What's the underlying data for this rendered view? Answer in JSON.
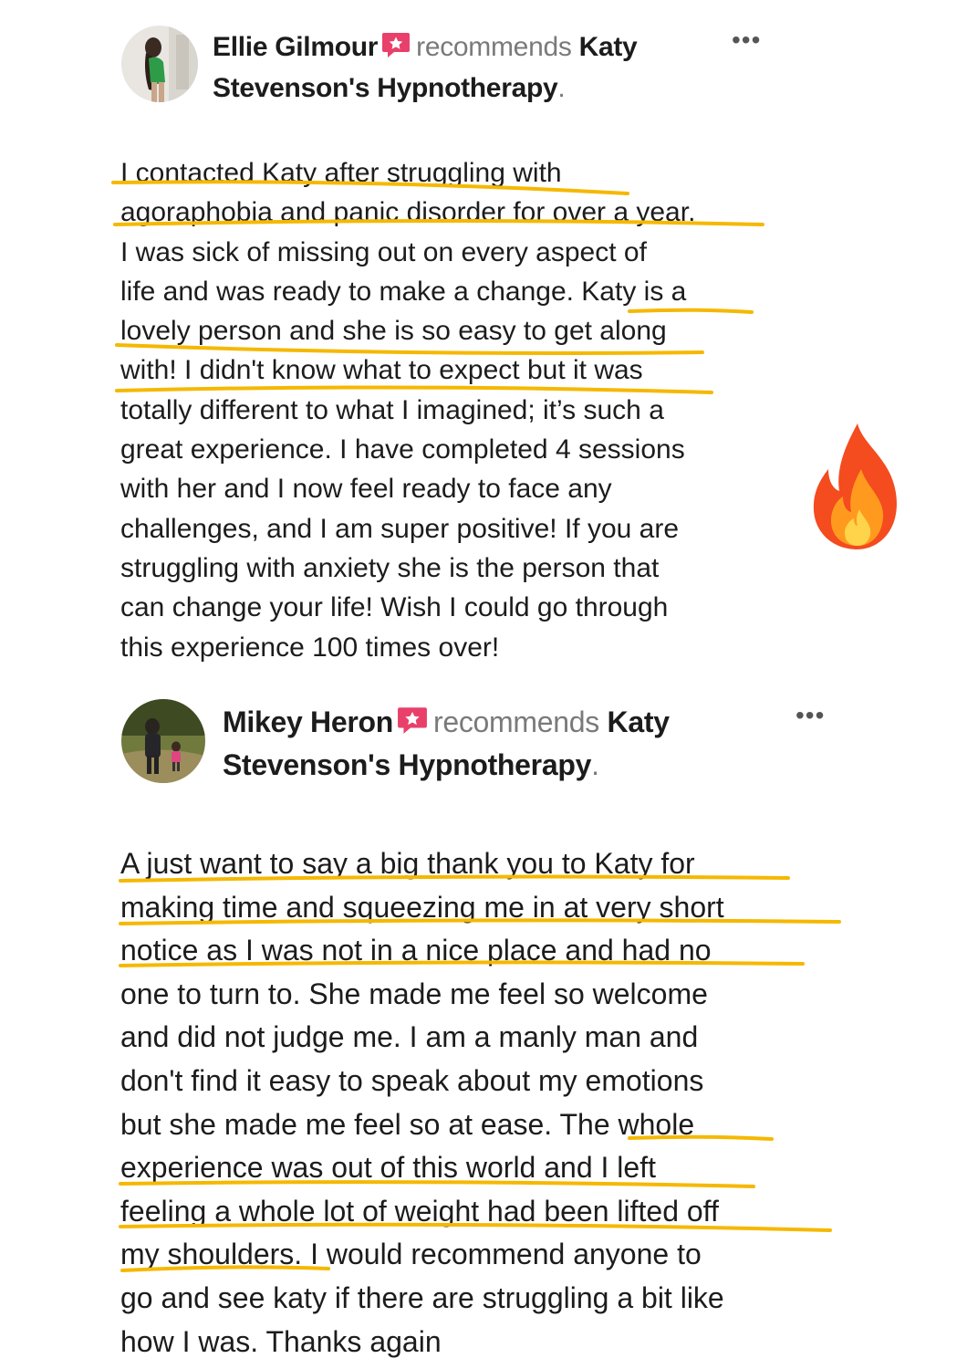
{
  "reviews": [
    {
      "author": "Ellie Gilmour",
      "recommends": "recommends",
      "business_line1": "Katy",
      "business_line2": "Stevenson's Hypnotherapy",
      "period": ".",
      "more": "•••",
      "body_lines": [
        "I contacted Katy after struggling with",
        "agoraphobia and panic disorder for over a year.",
        "I was sick of missing out on every aspect of",
        "life and was ready to make a change. Katy is a",
        "lovely person and she is so easy to get along",
        "with! I didn't know what to expect but it was",
        "totally different to what I imagined; it’s such a",
        "great experience. I have completed 4 sessions",
        "with her and I now feel ready to face any",
        "challenges, and I am super positive! If you are",
        "struggling with anxiety she is the person that",
        "can change your life! Wish I could go through",
        "this experience 100 times over!"
      ]
    },
    {
      "author": "Mikey Heron",
      "recommends": "recommends",
      "business_line1": "Katy",
      "business_line2": "Stevenson's Hypnotherapy",
      "period": ".",
      "more": "•••",
      "body_lines": [
        "A just want to say a big thank you to Katy for",
        "making time and squeezing me in at very short",
        "notice as I was not in a nice place and had no",
        "one to turn to. She made me feel so welcome",
        "and did not judge me. I am a manly man and",
        "don't find it easy to speak about my emotions",
        "but she made me feel so at ease. The whole",
        "experience was out of this world and I left",
        "feeling a whole lot of weight had been lifted off",
        "my shoulders. I would recommend anyone to",
        "go and see katy if there are struggling a bit like",
        "how I was. Thanks again"
      ]
    }
  ],
  "colors": {
    "highlight": "#f5b800",
    "badge": "#e8406a",
    "muted_text": "#7a7a7a"
  },
  "icons": {
    "recommend_badge": "recommend-badge-icon",
    "more": "more-options-icon",
    "fire": "fire-emoji-icon"
  }
}
